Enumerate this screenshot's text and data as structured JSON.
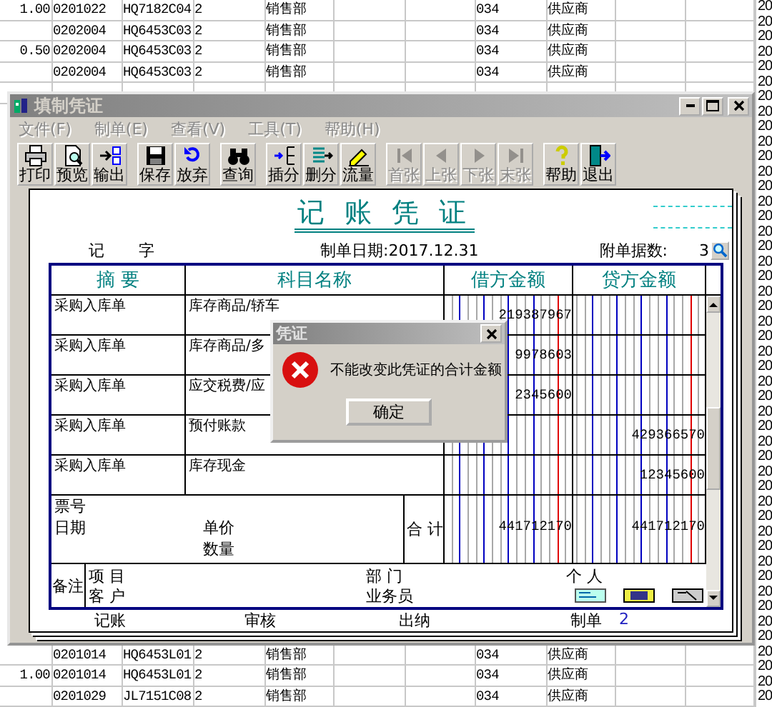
{
  "sheet": {
    "top_rows": [
      {
        "column_1": "1.00",
        "column_2": "0201022",
        "column_3": "HQ7182C04",
        "column_4": "2",
        "column_5": "销售部",
        "column_6": "034",
        "column_7": "供应商"
      },
      {
        "column_2": "0202004",
        "column_3": "HQ6453C03",
        "column_4": "2",
        "column_5": "销售部",
        "column_6": "034",
        "column_7": "供应商"
      },
      {
        "column_1": "0.50",
        "column_2": "0202004",
        "column_3": "HQ6453C03",
        "column_4": "2",
        "column_5": "销售部",
        "column_6": "034",
        "column_7": "供应商"
      },
      {
        "column_2": "0202004",
        "column_3": "HQ6453C03",
        "column_4": "2",
        "column_5": "销售部",
        "column_6": "034",
        "column_7": "供应商"
      }
    ],
    "bottom_rows": [
      {
        "column_2": "0201014",
        "column_3": "HQ6453L01",
        "column_4": "2",
        "column_5": "销售部",
        "column_6": "034",
        "column_7": "供应商"
      },
      {
        "column_1": "1.00",
        "column_2": "0201014",
        "column_3": "HQ6453L01",
        "column_4": "2",
        "column_5": "销售部",
        "column_6": "034",
        "column_7": "供应商"
      },
      {
        "column_2": "0201029",
        "column_3": "JL7151C08",
        "column_4": "2",
        "column_5": "销售部",
        "column_6": "034",
        "column_7": "供应商"
      }
    ],
    "right_column": [
      "20",
      "20",
      "20",
      "20",
      "20",
      "20",
      "20",
      "20",
      "20",
      "20",
      "20",
      "20",
      "20",
      "20",
      "20",
      "20",
      "20",
      "20",
      "20",
      "20",
      "20",
      "20",
      "20",
      "20",
      "20",
      "20",
      "20",
      "20",
      "20",
      "20",
      "20",
      "20",
      "20",
      "20",
      "20",
      "20",
      "20",
      "20",
      "20",
      "20",
      "20",
      "20",
      "20",
      "20",
      "20",
      "20",
      "20"
    ]
  },
  "window": {
    "title": "填制凭证",
    "menu": [
      {
        "label": "文件(F)",
        "disabled": true
      },
      {
        "label": "制单(E)",
        "disabled": true
      },
      {
        "label": "查看(V)",
        "disabled": true
      },
      {
        "label": "工具(T)",
        "disabled": true
      },
      {
        "label": "帮助(H)",
        "disabled": true
      }
    ],
    "toolbar": [
      [
        {
          "label": "打印",
          "disabled": false
        },
        {
          "label": "预览",
          "disabled": false
        },
        {
          "label": "输出",
          "disabled": false
        }
      ],
      [
        {
          "label": "保存",
          "disabled": false
        },
        {
          "label": "放弃",
          "disabled": false
        }
      ],
      [
        {
          "label": "查询",
          "disabled": false
        }
      ],
      [
        {
          "label": "插分",
          "disabled": false
        },
        {
          "label": "删分",
          "disabled": false
        },
        {
          "label": "流量",
          "disabled": false
        }
      ],
      [
        {
          "label": "首张",
          "disabled": true
        },
        {
          "label": "上张",
          "disabled": true
        },
        {
          "label": "下张",
          "disabled": true
        },
        {
          "label": "末张",
          "disabled": true
        }
      ],
      [
        {
          "label": "帮助",
          "disabled": false
        },
        {
          "label": "退出",
          "disabled": false
        }
      ]
    ]
  },
  "voucher": {
    "title": "记 账 凭 证",
    "type_label": [
      "记",
      "字"
    ],
    "date": "制单日期:2017.12.31",
    "attachments_label": "附单据数:",
    "attachments": "3",
    "columns": [
      "摘 要",
      "科目名称",
      "借方金额",
      "贷方金额"
    ],
    "entries": [
      {
        "summary": "采购入库单",
        "subject": "库存商品/轿车",
        "debit": "219387967"
      },
      {
        "summary": "采购入库单",
        "subject": "库存商品/多",
        "debit": "9978603"
      },
      {
        "summary": "采购入库单",
        "subject": "应交税费/应",
        "debit": "2345600"
      },
      {
        "summary": "采购入库单",
        "subject": "预付账款",
        "credit": "429366570"
      },
      {
        "summary": "采购入库单",
        "subject": "库存现金",
        "credit": "12345600"
      }
    ],
    "ticket_label": "票号",
    "date_label": "日期",
    "price_label": "单价",
    "quantity_label": "数量",
    "total_label": "合 计",
    "total_debit": "441712170",
    "total_credit": "441712170",
    "notes_label": "备注",
    "project_label": "项 目",
    "customer_label": "客 户",
    "department_label": "部 门",
    "salesperson_label": "业务员",
    "person_label": "个 人",
    "signatures": [
      {
        "label": "记账"
      },
      {
        "label": "审核"
      },
      {
        "label": "出纳"
      },
      {
        "label": "制单",
        "value": "2"
      }
    ]
  },
  "dialog": {
    "title": "凭证",
    "message": "不能改变此凭证的合计金额",
    "button": "确定"
  }
}
